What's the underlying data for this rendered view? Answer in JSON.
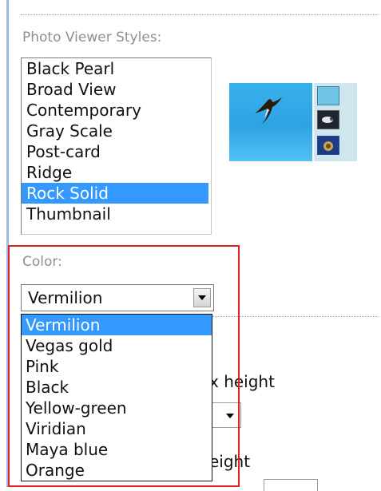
{
  "styles_section": {
    "label": "Photo Viewer Styles:",
    "items": [
      "Black Pearl",
      "Broad View",
      "Contemporary",
      "Gray Scale",
      "Post-card",
      "Ridge",
      "Rock Solid",
      "Thumbnail"
    ],
    "selected": "Rock Solid"
  },
  "color_section": {
    "label": "Color:",
    "value": "Vermilion",
    "options": [
      "Vermilion",
      "Vegas gold",
      "Pink",
      "Black",
      "Yellow-green",
      "Viridian",
      "Maya blue",
      "Orange"
    ],
    "highlighted": "Vermilion"
  },
  "background": {
    "max_height_fragment": "x height",
    "height_fragment": "eight"
  },
  "colors": {
    "selection": "#3399ff",
    "highlight_border": "#e02020",
    "left_rule": "#9dbbe3"
  }
}
